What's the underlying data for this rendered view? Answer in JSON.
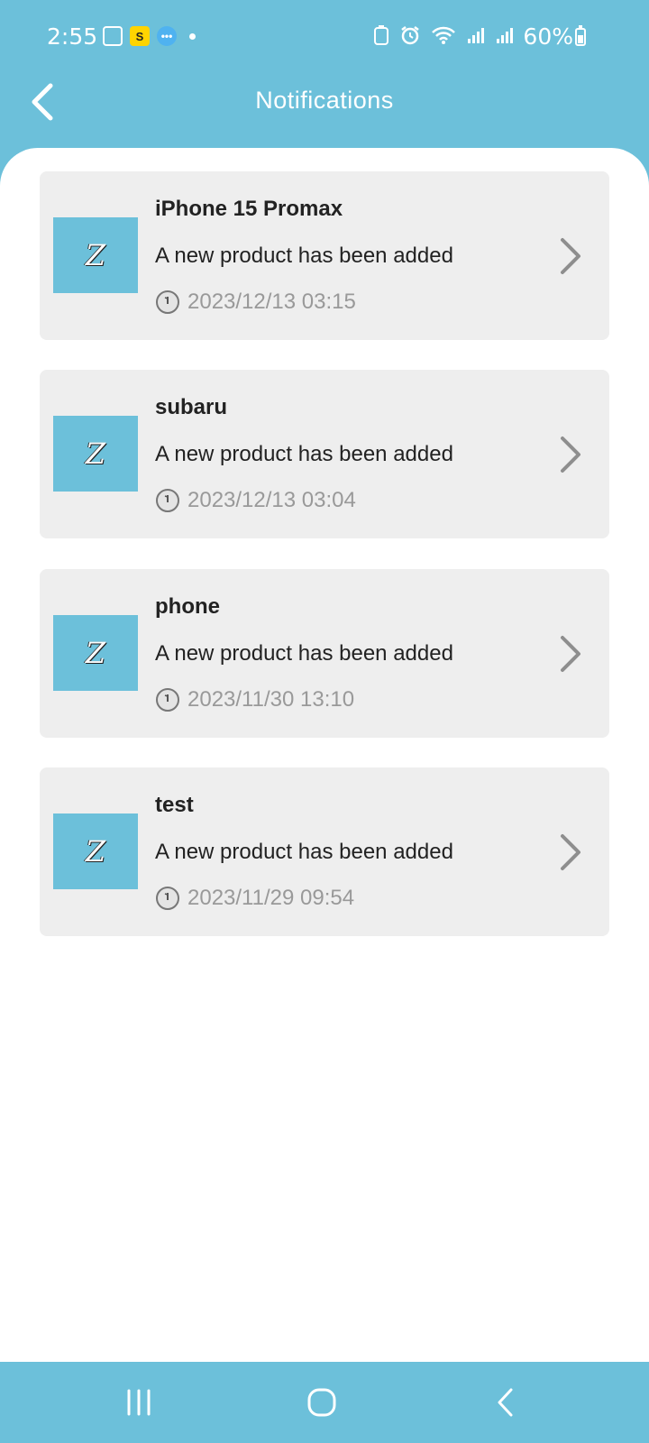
{
  "status_bar": {
    "time": "2:55",
    "battery": "60%",
    "icons_left": [
      "gallery-icon",
      "yellow-app-icon",
      "chat-app-icon",
      "notification-dot"
    ],
    "icons_right": [
      "battery-saver-icon",
      "alarm-icon",
      "wifi-icon",
      "signal-icon",
      "signal-icon"
    ]
  },
  "header": {
    "title": "Notifications",
    "back_icon": "chevron-left-icon"
  },
  "colors": {
    "brand": "#6cc0da",
    "card_bg": "#eeeeee",
    "muted_text": "#999999"
  },
  "notifications": [
    {
      "thumb": "Z",
      "title": "iPhone 15 Promax",
      "message": "A new product has been added",
      "time": "2023/12/13 03:15"
    },
    {
      "thumb": "Z",
      "title": "subaru",
      "message": "A new product has been added",
      "time": "2023/12/13 03:04"
    },
    {
      "thumb": "Z",
      "title": "phone",
      "message": "A new product has been added",
      "time": "2023/11/30 13:10"
    },
    {
      "thumb": "Z",
      "title": "test",
      "message": "A new product has been added",
      "time": "2023/11/29 09:54"
    }
  ],
  "nav_bar": {
    "buttons": [
      "recent-apps-icon",
      "home-icon",
      "back-icon"
    ]
  }
}
